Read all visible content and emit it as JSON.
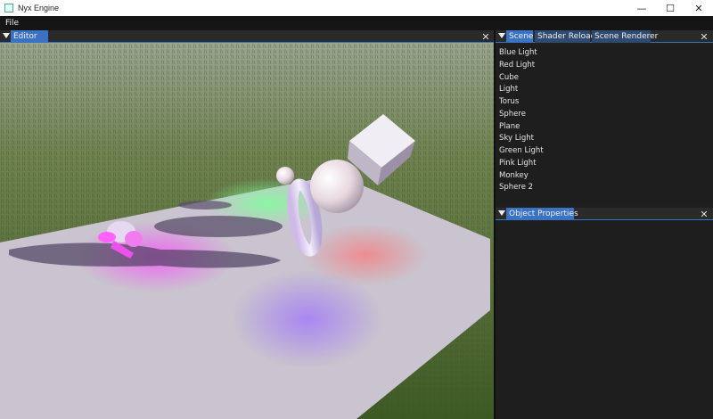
{
  "window": {
    "title": "Nyx Engine",
    "minimize": "—",
    "maximize": "☐",
    "close": "✕"
  },
  "menu": {
    "items": [
      {
        "label": "File"
      }
    ]
  },
  "editor": {
    "tab_label": "Editor",
    "close": "✕"
  },
  "scene_panel": {
    "tabs": [
      {
        "label": "Scene"
      },
      {
        "label": "Shader Reload"
      },
      {
        "label": "Scene Renderer"
      }
    ],
    "close": "✕",
    "items": [
      {
        "label": "Blue Light"
      },
      {
        "label": "Red Light"
      },
      {
        "label": "Cube"
      },
      {
        "label": "Light"
      },
      {
        "label": "Torus"
      },
      {
        "label": "Sphere"
      },
      {
        "label": "Plane"
      },
      {
        "label": "Sky Light"
      },
      {
        "label": "Green Light"
      },
      {
        "label": "Pink Light"
      },
      {
        "label": "Monkey"
      },
      {
        "label": "Sphere 2"
      }
    ]
  },
  "object_properties": {
    "tab_label": "Object Properties",
    "close": "✕"
  },
  "colors": {
    "accent": "#3b73c4",
    "panel_bg": "#1e1e1e",
    "grass": "#5d7a3a"
  }
}
